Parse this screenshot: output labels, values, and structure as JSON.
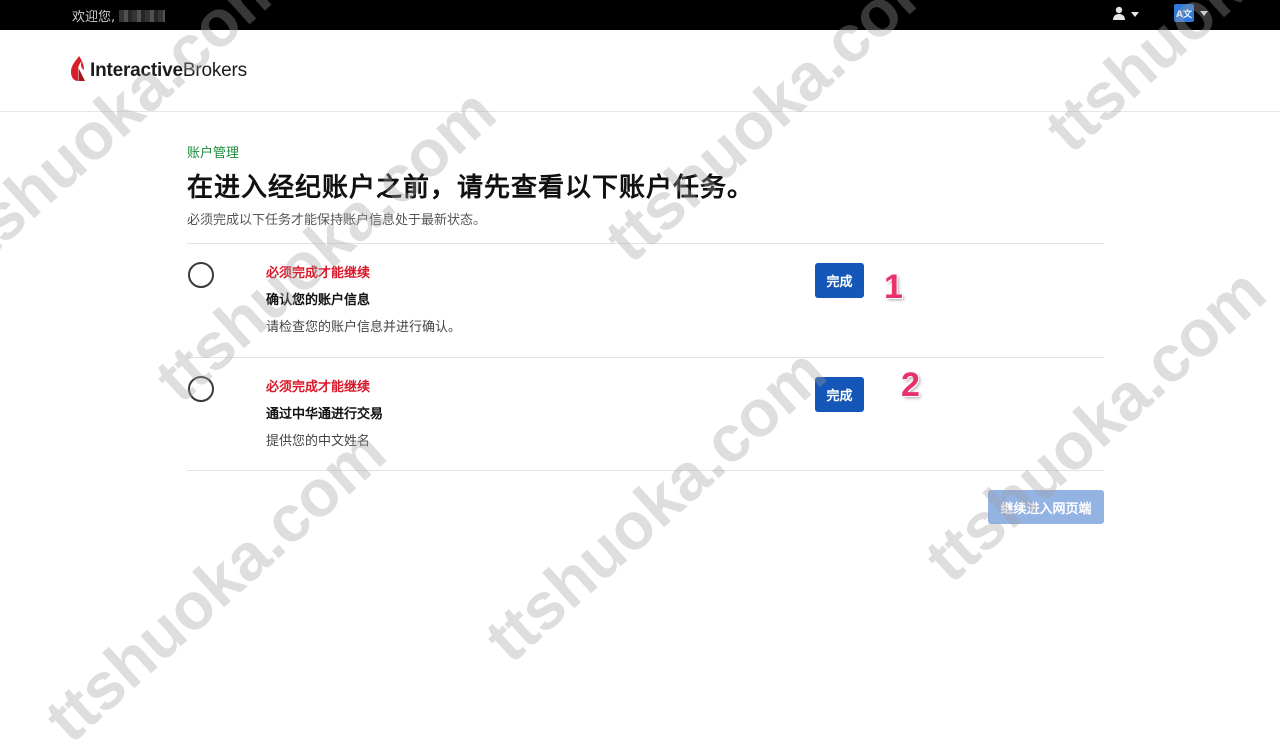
{
  "topbar": {
    "welcome_text": "欢迎您,",
    "user_menu_icon": "user-icon",
    "language_icon": "translate-icon",
    "language_glyph": "A文"
  },
  "header": {
    "logo_part1": "Interactive",
    "logo_part2": "Brokers"
  },
  "page": {
    "breadcrumb": "账户管理",
    "title": "在进入经纪账户之前，请先查看以下账户任务。",
    "subtitle": "必须完成以下任务才能保持账户信息处于最新状态。"
  },
  "tasks": [
    {
      "required_label": "必须完成才能继续",
      "title": "确认您的账户信息",
      "description": "请检查您的账户信息并进行确认。",
      "button_label": "完成",
      "step_number": "1"
    },
    {
      "required_label": "必须完成才能继续",
      "title": "通过中华通进行交易",
      "description": "提供您的中文姓名",
      "button_label": "完成",
      "step_number": "2"
    }
  ],
  "continue_button": "继续进入网页端",
  "watermark_text": "ttshuoka.com",
  "colors": {
    "accent_blue": "#1557b8",
    "disabled_blue": "#93b3e3",
    "breadcrumb_green": "#1a8a3a",
    "required_red": "#d8192a",
    "logo_red": "#d81e2b",
    "step_pink": "#e8336a"
  }
}
